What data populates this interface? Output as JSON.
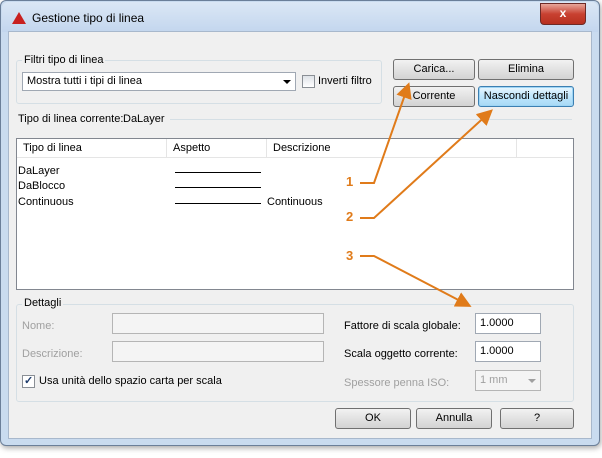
{
  "window": {
    "title": "Gestione tipo di linea",
    "close_glyph": "x"
  },
  "filter": {
    "group_label": "Filtri tipo di linea",
    "selected": "Mostra tutti i tipi di linea",
    "invert_label": "Inverti filtro",
    "invert_checked": false
  },
  "buttons": {
    "load": "Carica...",
    "delete": "Elimina",
    "current": "Corrente",
    "hide_details": "Nascondi dettagli",
    "ok": "OK",
    "cancel": "Annulla",
    "help": "?"
  },
  "current_linetype": {
    "label": "Tipo di linea corrente:",
    "value": "DaLayer"
  },
  "table": {
    "columns": [
      "Tipo di linea",
      "Aspetto",
      "Descrizione"
    ],
    "rows": [
      {
        "name": "DaLayer",
        "description": ""
      },
      {
        "name": "DaBlocco",
        "description": ""
      },
      {
        "name": "Continuous",
        "description": "Continuous"
      }
    ]
  },
  "callouts": [
    "1",
    "2",
    "3"
  ],
  "details": {
    "group_label": "Dettagli",
    "name_label": "Nome:",
    "name_value": "",
    "description_label": "Descrizione:",
    "description_value": "",
    "paperspace_label": "Usa unità dello spazio carta per scala",
    "paperspace_checked": true,
    "global_scale_label": "Fattore di scala globale:",
    "global_scale_value": "1.0000",
    "object_scale_label": "Scala oggetto corrente:",
    "object_scale_value": "1.0000",
    "iso_pen_label": "Spessore penna ISO:",
    "iso_pen_value": "1 mm"
  },
  "colors": {
    "callout": "#e07b1a",
    "title_bar": "#c3d6ee",
    "dialog_bg": "#f0f0f0"
  }
}
